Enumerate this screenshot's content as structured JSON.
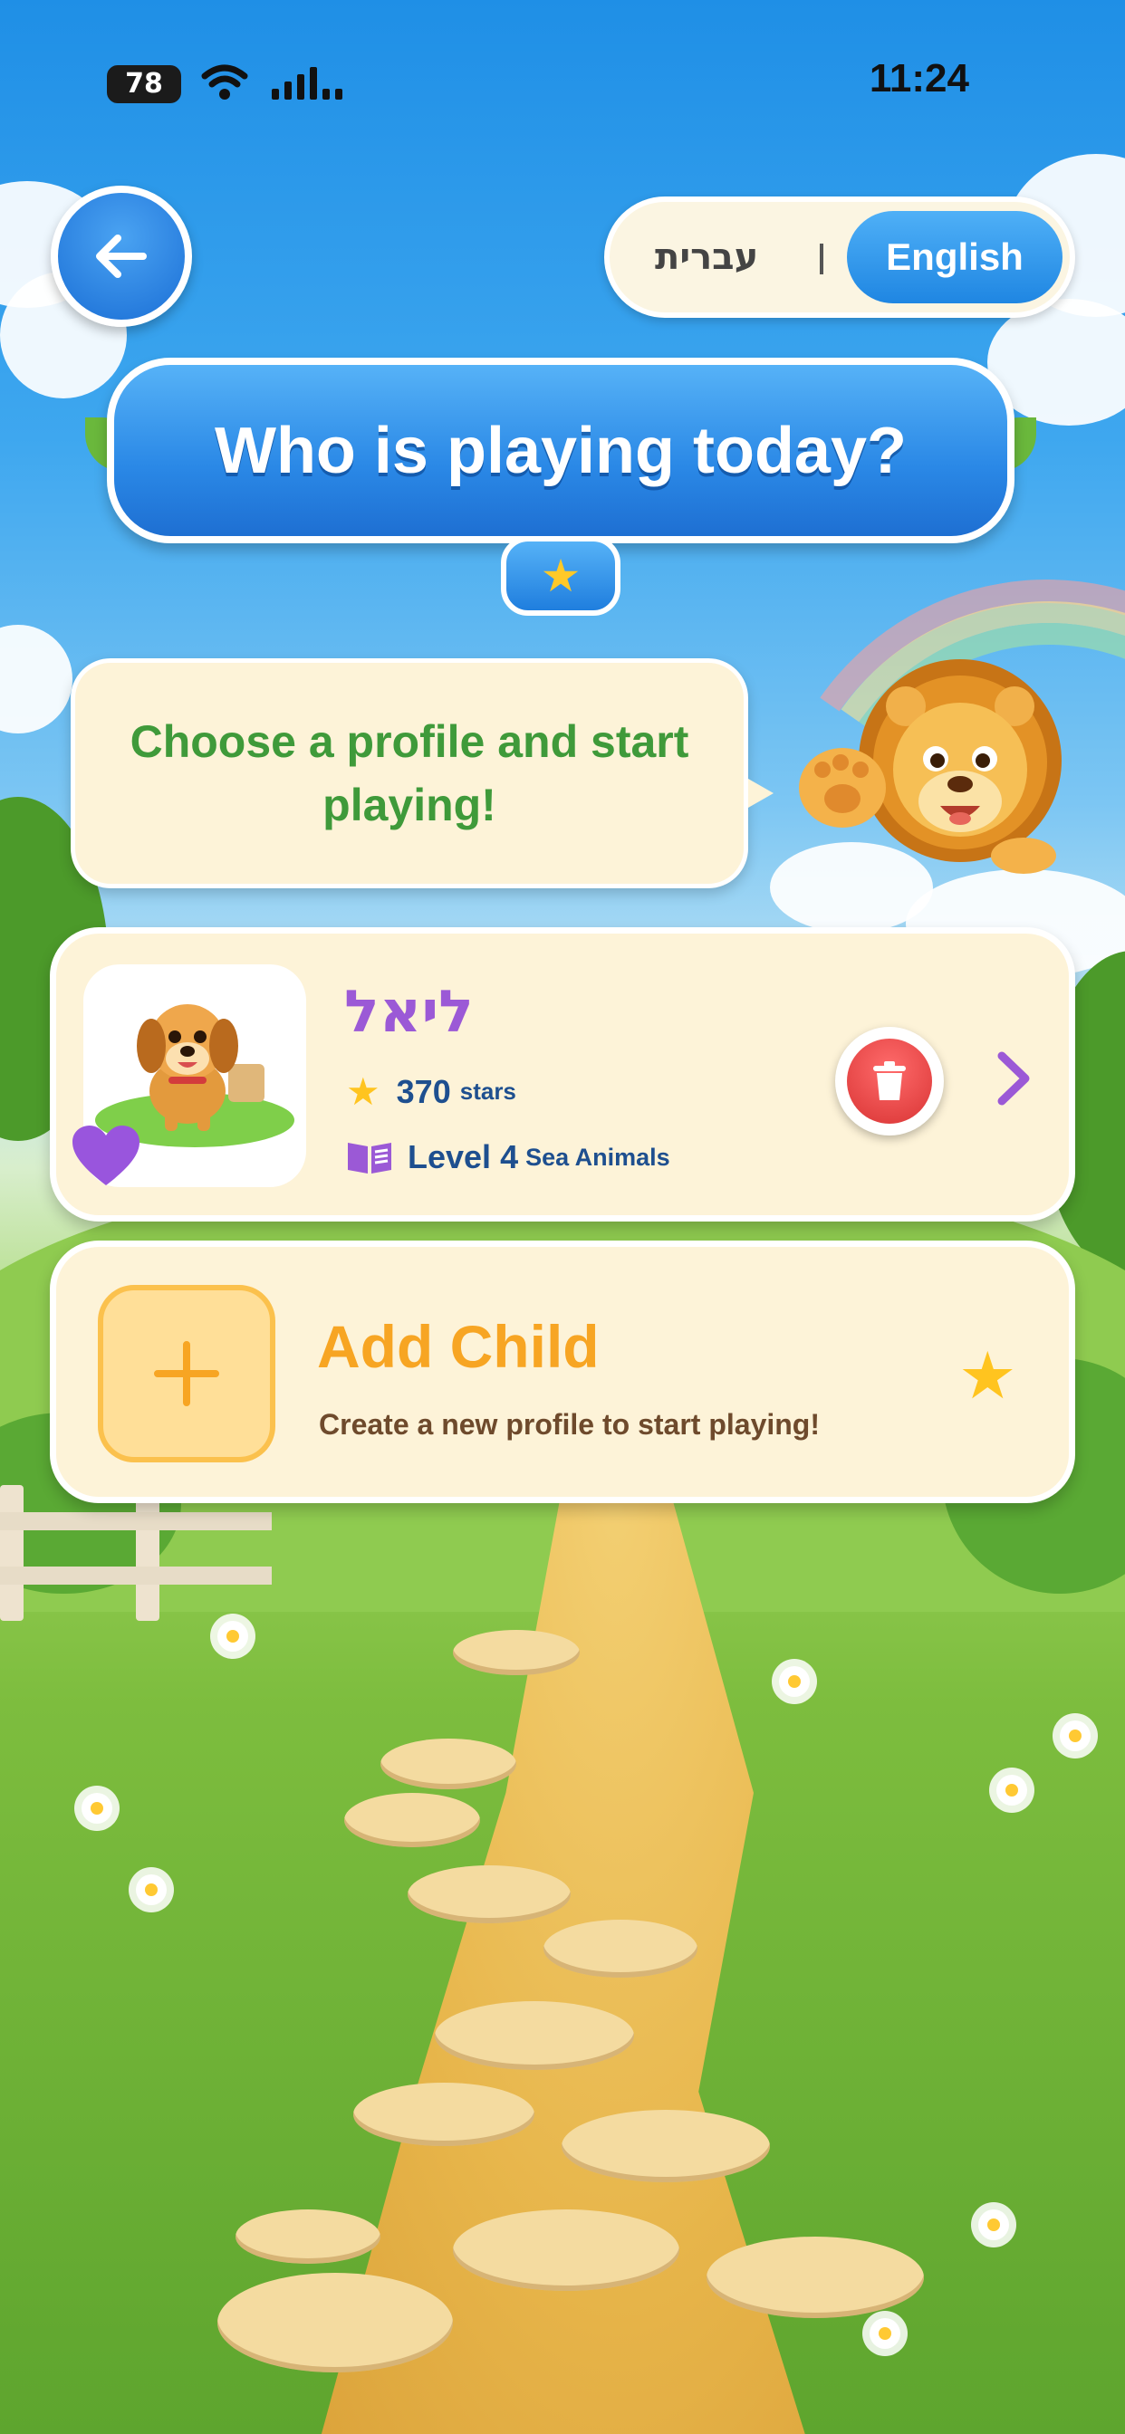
{
  "status_bar": {
    "battery": "78",
    "time": "11:24"
  },
  "language": {
    "hebrew_label": "עברית",
    "english_label": "English",
    "selected": "English"
  },
  "header": {
    "title": "Who is playing today?"
  },
  "mascot": {
    "speech": "Choose a profile and start playing!"
  },
  "profiles": [
    {
      "name": "ליאל",
      "stars": "370",
      "stars_unit": "stars",
      "level_label": "Level",
      "level_number": "4",
      "level_category": "Sea Animals"
    }
  ],
  "add_child": {
    "title": "Add Child",
    "subtitle": "Create a new profile to start playing!"
  },
  "icons": {
    "back": "arrow-left-icon",
    "delete": "trash-icon",
    "open": "chevron-right-icon",
    "add": "plus-icon",
    "star": "star-icon",
    "level": "book-icon",
    "favorite": "heart-icon"
  },
  "colors": {
    "primary_blue": "#2a88e6",
    "card_cream": "#fdf3d8",
    "speech_green": "#3f9a3a",
    "name_purple": "#9b59d6",
    "add_orange": "#f7a523",
    "delete_red": "#d93434",
    "star_yellow": "#ffc41f"
  }
}
